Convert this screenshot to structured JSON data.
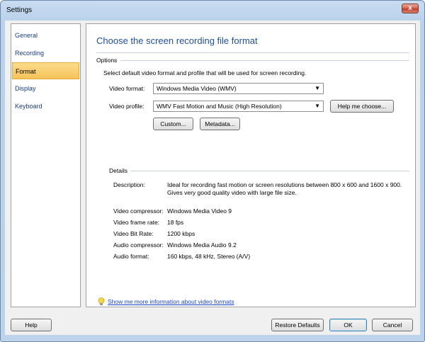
{
  "window": {
    "title": "Settings",
    "close_glyph": "x"
  },
  "sidebar": {
    "items": [
      {
        "label": "General"
      },
      {
        "label": "Recording"
      },
      {
        "label": "Format"
      },
      {
        "label": "Display"
      },
      {
        "label": "Keyboard"
      }
    ],
    "selected": "Format"
  },
  "main": {
    "heading": "Choose the screen recording file format",
    "options": {
      "section_label": "Options",
      "instruction": "Select default video format and profile that will be used for screen recording.",
      "video_format_label": "Video format:",
      "video_format_value": "Windows Media Video (WMV)",
      "video_profile_label": "Video profile:",
      "video_profile_value": "WMV Fast Motion and Music (High Resolution)",
      "help_choose_label": "Help me choose...",
      "custom_label": "Custom...",
      "metadata_label": "Metadata..."
    },
    "details": {
      "section_label": "Details",
      "description_label": "Description:",
      "description_value": "Ideal for recording fast motion or screen resolutions between 800 x 600 and 1600 x 900. Gives very good quality video with large file size.",
      "rows": [
        {
          "label": "Video compressor:",
          "value": "Windows Media Video 9"
        },
        {
          "label": "Video frame rate:",
          "value": "18 fps"
        },
        {
          "label": "Video Bit Rate:",
          "value": "1200 kbps"
        },
        {
          "label": "Audio compressor:",
          "value": "Windows Media Audio 9.2"
        },
        {
          "label": "Audio format:",
          "value": "160 kbps, 48 kHz, Stereo (A/V)"
        }
      ]
    },
    "info_link": "Show me more information about video formats"
  },
  "footer": {
    "help_label": "Help",
    "restore_label": "Restore Defaults",
    "ok_label": "OK",
    "cancel_label": "Cancel"
  },
  "colors": {
    "accent": "#1f4e9c",
    "selected_bg": "#f6c35a",
    "link": "#1a45c9"
  },
  "icons": {
    "bulb": "lightbulb-icon",
    "dropdown": "chevron-down-icon",
    "close": "close-icon"
  }
}
